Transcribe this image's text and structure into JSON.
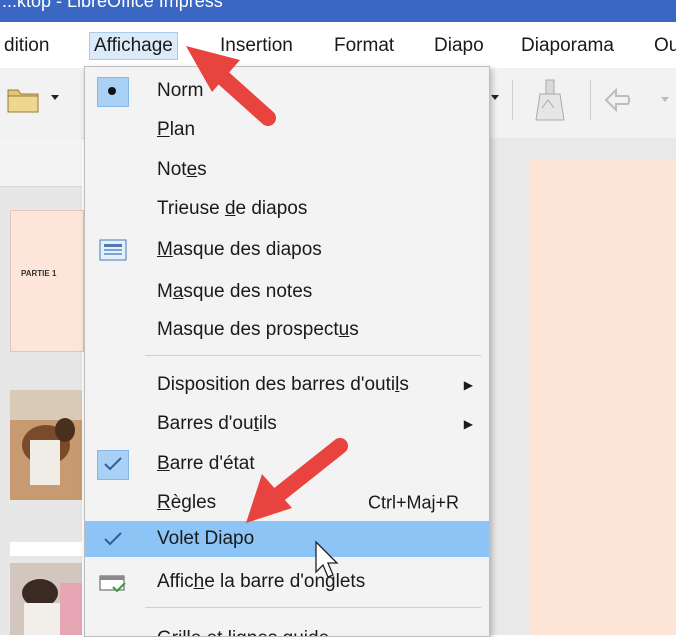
{
  "titlebar": {
    "text": "...ktop - LibreOffice Impress"
  },
  "menubar": {
    "items": [
      {
        "label": "dition"
      },
      {
        "label": "Affichage"
      },
      {
        "label": "Insertion"
      },
      {
        "label": "Format"
      },
      {
        "label": "Diapo"
      },
      {
        "label": "Diaporama"
      },
      {
        "label": "Ou"
      }
    ]
  },
  "left_pane": {
    "thumb_label": "PARTIE 1"
  },
  "dropdown": {
    "items": [
      {
        "pre": "Nor",
        "ul": "",
        "post": "m",
        "name": "normal"
      },
      {
        "pre": "",
        "ul": "P",
        "post": "lan",
        "name": "plan"
      },
      {
        "pre": "Not",
        "ul": "e",
        "post": "s",
        "name": "notes"
      },
      {
        "pre": "Trieuse ",
        "ul": "d",
        "post": "e diapos",
        "name": "trieuse"
      },
      {
        "pre": "",
        "ul": "M",
        "post": "asque des diapos",
        "name": "masque-diapos"
      },
      {
        "pre": "M",
        "ul": "a",
        "post": "sque des notes",
        "name": "masque-notes"
      },
      {
        "pre": "Masque des prospect",
        "ul": "u",
        "post": "s",
        "name": "masque-prospectus"
      },
      {
        "pre": "Disposition des barres d'outi",
        "ul": "l",
        "post": "s",
        "name": "disposition-barres"
      },
      {
        "pre": "Barres d'ou",
        "ul": "t",
        "post": "ils",
        "name": "barres-outils"
      },
      {
        "pre": "",
        "ul": "B",
        "post": "arre d'état",
        "name": "barre-etat"
      },
      {
        "pre": "",
        "ul": "R",
        "post": "ègles",
        "name": "regles"
      },
      {
        "pre": "Volet Diapo",
        "ul": "",
        "post": "",
        "name": "volet-diapo"
      },
      {
        "pre": "Affic",
        "ul": "h",
        "post": "e la barre d'onglets",
        "name": "affiche-onglets"
      },
      {
        "pre": "Grille et lignes guide",
        "ul": "",
        "post": "",
        "name": "grille"
      }
    ],
    "regles_shortcut": "Ctrl+Maj+R"
  },
  "colors": {
    "menu_highlight": "#8cc4f5",
    "active_menu_bg": "#dbeaf8",
    "arrow": "#e8433f",
    "slide_bg": "#fce4d6"
  },
  "icons": {
    "normal": "bullet-dot-icon",
    "masque_diapos": "slide-master-icon",
    "barre_etat": "checkmark-icon",
    "volet_diapo": "checkmark-icon",
    "affiche_onglets": "tab-bar-icon",
    "submenu": "submenu-arrow-icon"
  }
}
